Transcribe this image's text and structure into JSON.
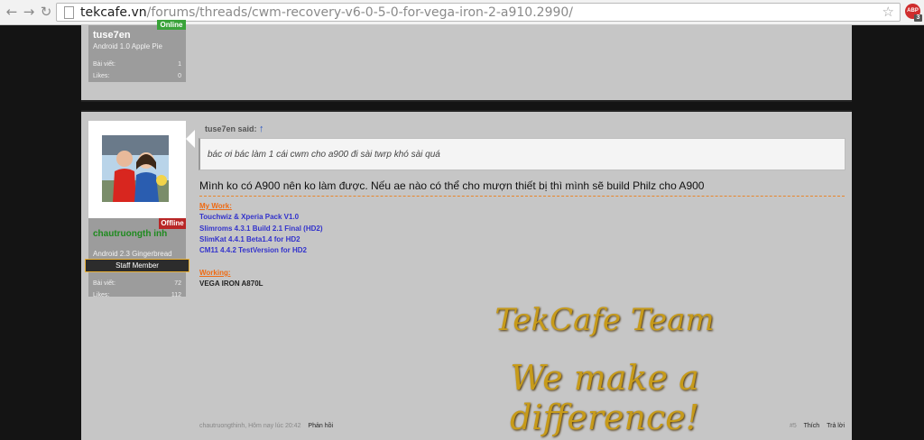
{
  "browser": {
    "url_host": "tekcafe.vn",
    "url_path": "/forums/threads/cwm-recovery-v6-0-5-0-for-vega-iron-2-a910.2990/",
    "abp_label": "ABP",
    "abp_count": "3"
  },
  "post1": {
    "username": "tuse7en",
    "user_title": "Android 1.0 Apple Pie",
    "status": "Online",
    "posts_label": "Bài viết:",
    "posts_value": "1",
    "likes_label": "Likes:",
    "likes_value": "0"
  },
  "post2": {
    "username": "chautruongth inh",
    "user_title": "Android 2.3 Gingerbread",
    "status": "Offline",
    "staff_label": "Staff Member",
    "posts_label": "Bài viết:",
    "posts_value": "72",
    "likes_label": "Likes:",
    "likes_value": "112",
    "quote_author": "tuse7en said:",
    "quote_arrow": "↑",
    "quote_text": "bác ơi bác làm 1 cái cwm cho a900 đi sài twrp khó sài quá",
    "message": "Mình ko có A900 nên ko làm được. Nếu ae nào có thể cho mượn thiết bị thì mình sẽ build Philz cho A900",
    "sig_heading1": "My Work:",
    "sig_links": [
      "Touchwiz & Xperia Pack V1.0",
      "Slimroms 4.3.1 Build 2.1 Final (HD2)",
      "SlimKat 4.4.1 Beta1.4 for HD2",
      "CM11 4.4.2 TestVersion for HD2"
    ],
    "sig_heading2": "Working:",
    "sig_working": "VEGA IRON A870L",
    "banner_line1": "TekCafe Team",
    "banner_line2": "We make a difference!",
    "footer_author_time": "chautruongthinh, Hôm nay lúc 20:42",
    "footer_reply": "Phản hồi",
    "footer_num": "#5",
    "footer_like": "Thích",
    "footer_reply2": "Trả lời"
  },
  "colors": {
    "accent_orange": "#ef6a12",
    "link_blue": "#3333cc",
    "online_green": "#39a339",
    "offline_red": "#b82626",
    "gold": "#c79b1a"
  }
}
